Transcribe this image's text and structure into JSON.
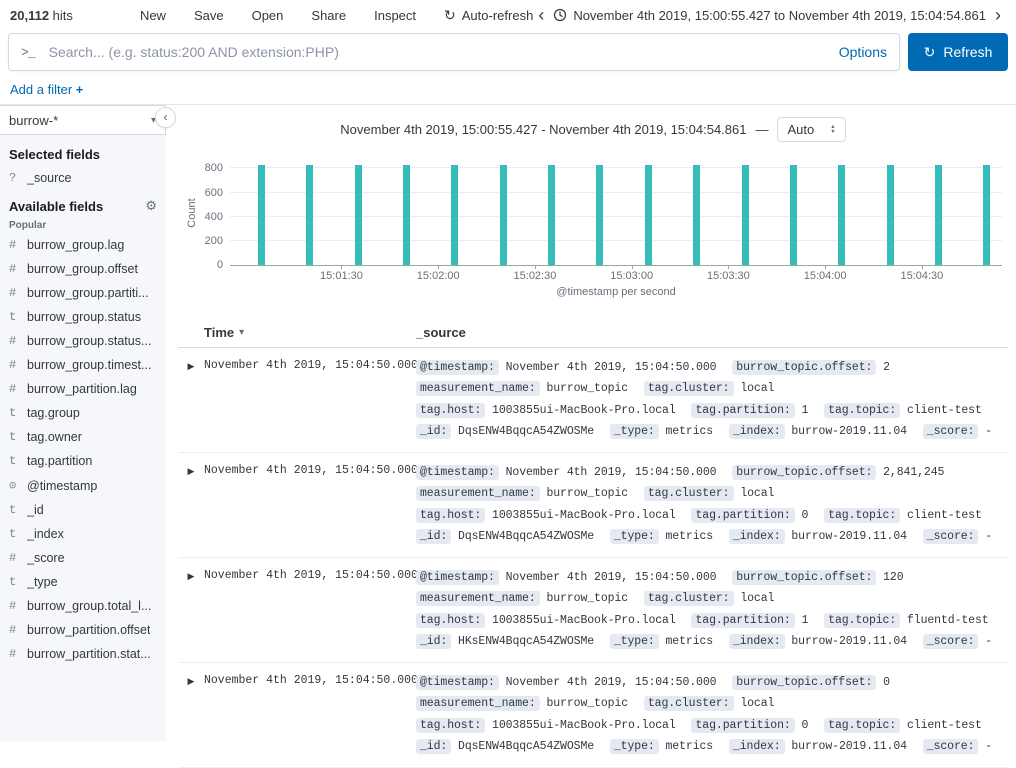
{
  "topbar": {
    "hits_count": "20,112",
    "hits_label": "hits",
    "menu": [
      "New",
      "Save",
      "Open",
      "Share",
      "Inspect"
    ],
    "auto_refresh_label": "Auto-refresh",
    "time_range_label": "November 4th 2019, 15:00:55.427 to November 4th 2019, 15:04:54.861"
  },
  "search": {
    "placeholder": "Search... (e.g. status:200 AND extension:PHP)",
    "options_label": "Options",
    "refresh_label": "Refresh"
  },
  "filters": {
    "add_filter_label": "Add a filter",
    "add_filter_plus": "+"
  },
  "sidebar": {
    "index_pattern": "burrow-*",
    "selected_fields_title": "Selected fields",
    "selected_fields": [
      {
        "type": "source",
        "name": "_source"
      }
    ],
    "available_fields_title": "Available fields",
    "popular_label": "Popular",
    "popular_fields": [
      {
        "type": "number",
        "name": "burrow_group.lag"
      },
      {
        "type": "number",
        "name": "burrow_group.offset"
      },
      {
        "type": "number",
        "name": "burrow_group.partiti..."
      },
      {
        "type": "string",
        "name": "burrow_group.status"
      },
      {
        "type": "number",
        "name": "burrow_group.status..."
      },
      {
        "type": "number",
        "name": "burrow_group.timest..."
      },
      {
        "type": "number",
        "name": "burrow_partition.lag"
      },
      {
        "type": "string",
        "name": "tag.group"
      },
      {
        "type": "string",
        "name": "tag.owner"
      },
      {
        "type": "string",
        "name": "tag.partition"
      }
    ],
    "other_fields": [
      {
        "type": "date",
        "name": "@timestamp"
      },
      {
        "type": "string",
        "name": "_id"
      },
      {
        "type": "string",
        "name": "_index"
      },
      {
        "type": "number",
        "name": "_score"
      },
      {
        "type": "string",
        "name": "_type"
      },
      {
        "type": "number",
        "name": "burrow_group.total_l..."
      },
      {
        "type": "number",
        "name": "burrow_partition.offset"
      },
      {
        "type": "number",
        "name": "burrow_partition.stat..."
      }
    ]
  },
  "histogram": {
    "range_label": "November 4th 2019, 15:00:55.427 - November 4th 2019, 15:04:54.861",
    "separator": "—",
    "interval_selected": "Auto"
  },
  "chart_data": {
    "type": "bar",
    "title": "",
    "xlabel": "@timestamp per second",
    "ylabel": "Count",
    "x_range": [
      "15:00:55.427",
      "15:04:54.861"
    ],
    "x": [
      "15:01:05",
      "15:01:20",
      "15:01:35",
      "15:01:50",
      "15:02:05",
      "15:02:20",
      "15:02:35",
      "15:02:50",
      "15:03:05",
      "15:03:20",
      "15:03:35",
      "15:03:50",
      "15:04:05",
      "15:04:20",
      "15:04:35",
      "15:04:50"
    ],
    "values": [
      830,
      832,
      829,
      831,
      830,
      833,
      828,
      831,
      830,
      829,
      832,
      830,
      831,
      829,
      830,
      832
    ],
    "y_ticks": [
      0,
      200,
      400,
      600,
      800
    ],
    "ylim": [
      0,
      870
    ],
    "x_tick_labels": [
      "15:01:30",
      "15:02:00",
      "15:02:30",
      "15:03:00",
      "15:03:30",
      "15:04:00",
      "15:04:30"
    ],
    "grid": true,
    "legend": false,
    "bar_color": "#35BEB7"
  },
  "table": {
    "columns": [
      "Time",
      "_source"
    ],
    "rows": [
      {
        "time": "November 4th 2019, 15:04:50.000",
        "source": [
          {
            "k": "@timestamp",
            "v": "November 4th 2019, 15:04:50.000"
          },
          {
            "k": "burrow_topic.offset",
            "v": "2"
          },
          {
            "k": "measurement_name",
            "v": "burrow_topic"
          },
          {
            "k": "tag.cluster",
            "v": "local"
          },
          {
            "k": "tag.host",
            "v": "1003855ui-MacBook-Pro.local"
          },
          {
            "k": "tag.partition",
            "v": "1"
          },
          {
            "k": "tag.topic",
            "v": "client-test"
          },
          {
            "k": "_id",
            "v": "DqsENW4BqqcA54ZWOSMe"
          },
          {
            "k": "_type",
            "v": "metrics"
          },
          {
            "k": "_index",
            "v": "burrow-2019.11.04"
          },
          {
            "k": "_score",
            "v": "-"
          }
        ]
      },
      {
        "time": "November 4th 2019, 15:04:50.000",
        "source": [
          {
            "k": "@timestamp",
            "v": "November 4th 2019, 15:04:50.000"
          },
          {
            "k": "burrow_topic.offset",
            "v": "2,841,245"
          },
          {
            "k": "measurement_name",
            "v": "burrow_topic"
          },
          {
            "k": "tag.cluster",
            "v": "local"
          },
          {
            "k": "tag.host",
            "v": "1003855ui-MacBook-Pro.local"
          },
          {
            "k": "tag.partition",
            "v": "0"
          },
          {
            "k": "tag.topic",
            "v": "client-test"
          },
          {
            "k": "_id",
            "v": "DqsENW4BqqcA54ZWOSMe"
          },
          {
            "k": "_type",
            "v": "metrics"
          },
          {
            "k": "_index",
            "v": "burrow-2019.11.04"
          },
          {
            "k": "_score",
            "v": "-"
          }
        ]
      },
      {
        "time": "November 4th 2019, 15:04:50.000",
        "source": [
          {
            "k": "@timestamp",
            "v": "November 4th 2019, 15:04:50.000"
          },
          {
            "k": "burrow_topic.offset",
            "v": "120"
          },
          {
            "k": "measurement_name",
            "v": "burrow_topic"
          },
          {
            "k": "tag.cluster",
            "v": "local"
          },
          {
            "k": "tag.host",
            "v": "1003855ui-MacBook-Pro.local"
          },
          {
            "k": "tag.partition",
            "v": "1"
          },
          {
            "k": "tag.topic",
            "v": "fluentd-test"
          },
          {
            "k": "_id",
            "v": "HKsENW4BqqcA54ZWOSMe"
          },
          {
            "k": "_type",
            "v": "metrics"
          },
          {
            "k": "_index",
            "v": "burrow-2019.11.04"
          },
          {
            "k": "_score",
            "v": "-"
          }
        ]
      },
      {
        "time": "November 4th 2019, 15:04:50.000",
        "source": [
          {
            "k": "@timestamp",
            "v": "November 4th 2019, 15:04:50.000"
          },
          {
            "k": "burrow_topic.offset",
            "v": "0"
          },
          {
            "k": "measurement_name",
            "v": "burrow_topic"
          },
          {
            "k": "tag.cluster",
            "v": "local"
          },
          {
            "k": "tag.host",
            "v": "1003855ui-MacBook-Pro.local"
          },
          {
            "k": "tag.partition",
            "v": "0"
          },
          {
            "k": "tag.topic",
            "v": "client-test"
          },
          {
            "k": "_id",
            "v": "DqsENW4BqqcA54ZWOSMe"
          },
          {
            "k": "_type",
            "v": "metrics"
          },
          {
            "k": "_index",
            "v": "burrow-2019.11.04"
          },
          {
            "k": "_score",
            "v": "-"
          }
        ]
      }
    ]
  }
}
